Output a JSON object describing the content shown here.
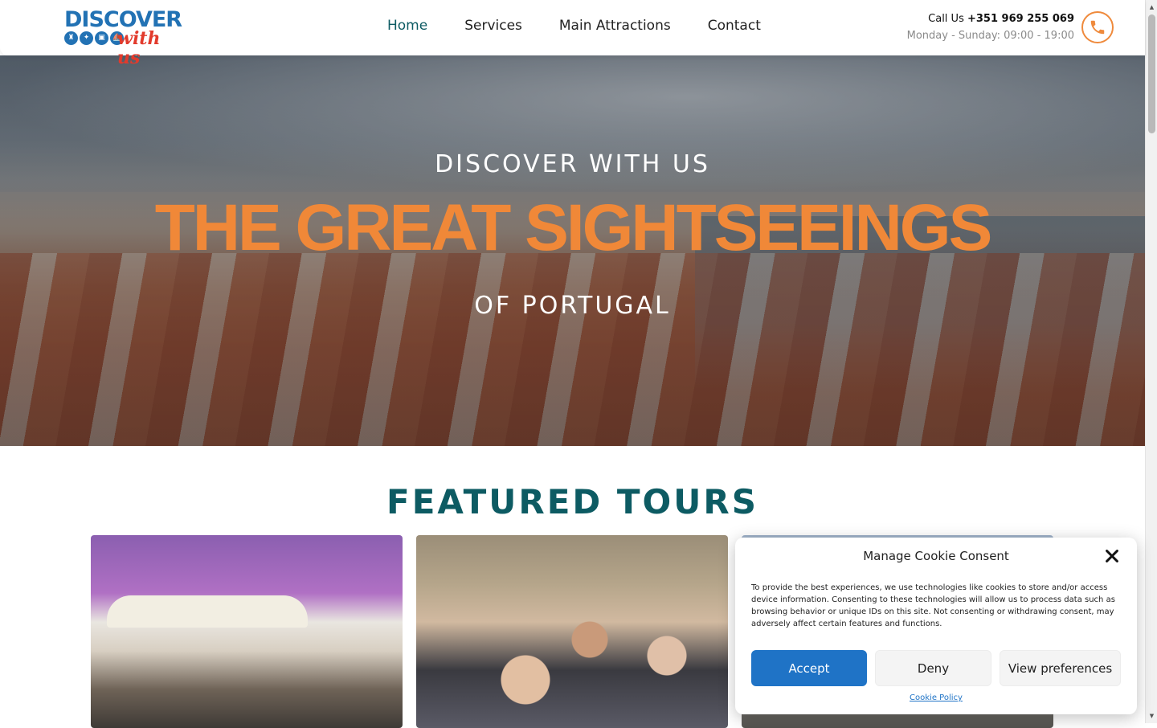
{
  "header": {
    "logo": {
      "line1": "DISCOVER",
      "line2": "with us"
    },
    "nav": [
      {
        "label": "Home",
        "active": true
      },
      {
        "label": "Services",
        "active": false
      },
      {
        "label": "Main Attractions",
        "active": false
      },
      {
        "label": "Contact",
        "active": false
      }
    ],
    "call_prefix": "Call Us",
    "phone": "+351 969 255 069",
    "hours": "Monday - Sunday: 09:00 - 19:00",
    "phone_icon": "phone-icon"
  },
  "hero": {
    "kicker": "DISCOVER WITH US",
    "title": "THE GREAT SIGHTSEEINGS",
    "subtitle": "OF PORTUGAL"
  },
  "featured": {
    "title": "FEATURED TOURS"
  },
  "cookie": {
    "title": "Manage Cookie Consent",
    "text": "To provide the best experiences, we use technologies like cookies to store and/or access device information. Consenting to these technologies will allow us to process data such as browsing behavior or unique IDs on this site. Not consenting or withdrawing consent, may adversely affect certain features and functions.",
    "accept": "Accept",
    "deny": "Deny",
    "preferences": "View preferences",
    "policy_link": "Cookie Policy"
  },
  "colors": {
    "accent_orange": "#f08838",
    "teal": "#0d5b63",
    "button_blue": "#1f73c6",
    "brand_blue": "#2272b4",
    "brand_red": "#e23a2c"
  }
}
